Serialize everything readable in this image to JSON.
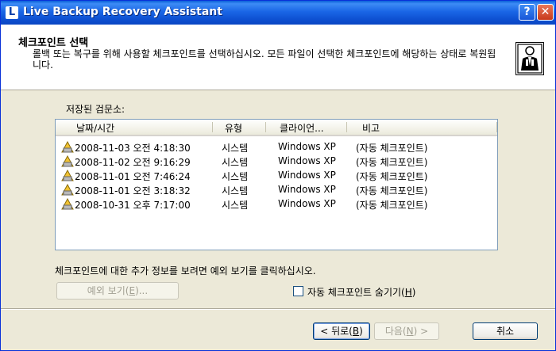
{
  "window": {
    "title": "Live Backup Recovery Assistant",
    "app_icon_letter": "L",
    "help_label": "?",
    "close_label": "✕"
  },
  "header": {
    "title": "체크포인트 선택",
    "description": "롤백 또는 복구를 위해 사용할 체크포인트를 선택하십시오. 모든 파일이 선택한 체크포인트에 해당하는 상태로 복원됩니다."
  },
  "list": {
    "label": "저장된 검문소:",
    "columns": [
      "날짜/시간",
      "유형",
      "클라이언...",
      "비고"
    ],
    "rows": [
      {
        "datetime": "2008-11-03 오전 4:18:30",
        "type": "시스템",
        "client": "Windows XP",
        "note": "(자동 체크포인트)"
      },
      {
        "datetime": "2008-11-02 오전 9:16:29",
        "type": "시스템",
        "client": "Windows XP",
        "note": "(자동 체크포인트)"
      },
      {
        "datetime": "2008-11-01 오전 7:46:24",
        "type": "시스템",
        "client": "Windows XP",
        "note": "(자동 체크포인트)"
      },
      {
        "datetime": "2008-11-01 오전 3:18:32",
        "type": "시스템",
        "client": "Windows XP",
        "note": "(자동 체크포인트)"
      },
      {
        "datetime": "2008-10-31 오후 7:17:00",
        "type": "시스템",
        "client": "Windows XP",
        "note": "(자동 체크포인트)"
      }
    ]
  },
  "info_text": "체크포인트에 대한 추가 정보를 보려면 예외 보기를 클릭하십시오.",
  "buttons": {
    "view_exceptions": {
      "label": "예외 보기(",
      "mnemonic": "E",
      "suffix": ")..."
    },
    "back": {
      "label": "< 뒤로(",
      "mnemonic": "B",
      "suffix": ")"
    },
    "next": {
      "label": "다음(",
      "mnemonic": "N",
      "suffix": ") >"
    },
    "cancel": {
      "label": "취소"
    }
  },
  "checkbox": {
    "label": "자동 체크포인트 숨기기(",
    "mnemonic": "H",
    "suffix": ")",
    "checked": false
  },
  "colors": {
    "titlebar": "#0a5fd8",
    "dialog_bg": "#ece9d8",
    "header_bg": "#ffffff"
  }
}
